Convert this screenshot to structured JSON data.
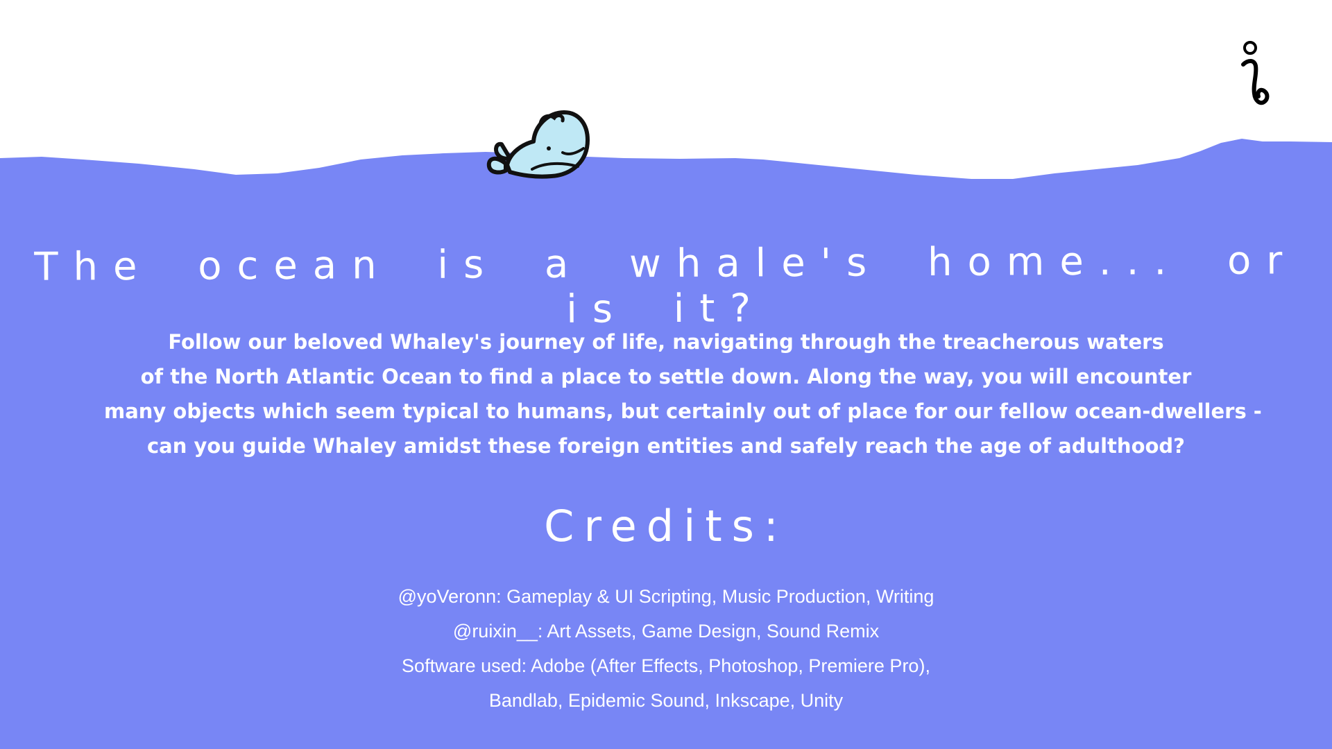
{
  "colors": {
    "ocean": "#7886F5",
    "sky": "#FFFFFF",
    "text": "#FFFFFF",
    "whale_body": "#BFE8F5",
    "outline": "#111111"
  },
  "header": {
    "info_icon": "info-icon"
  },
  "mascot": {
    "icon": "whale-icon"
  },
  "main": {
    "headline": "The ocean is a whale's home... or is it?",
    "description_lines": [
      "Follow our beloved Whaley's journey of life, navigating through the treacherous waters",
      "of the North Atlantic Ocean to find a place to settle down. Along the way, you will encounter",
      "many objects which seem typical to humans, but certainly out of place for our fellow ocean-dwellers -",
      "can you guide Whaley amidst these foreign entities and safely reach the age of adulthood?"
    ],
    "credits_title": "Credits:",
    "credits_lines": [
      "@yoVeronn: Gameplay & UI Scripting, Music Production, Writing",
      "@ruixin__: Art Assets, Game Design, Sound Remix",
      "Software used: Adobe (After Effects, Photoshop, Premiere Pro),",
      "Bandlab, Epidemic Sound, Inkscape, Unity"
    ]
  }
}
